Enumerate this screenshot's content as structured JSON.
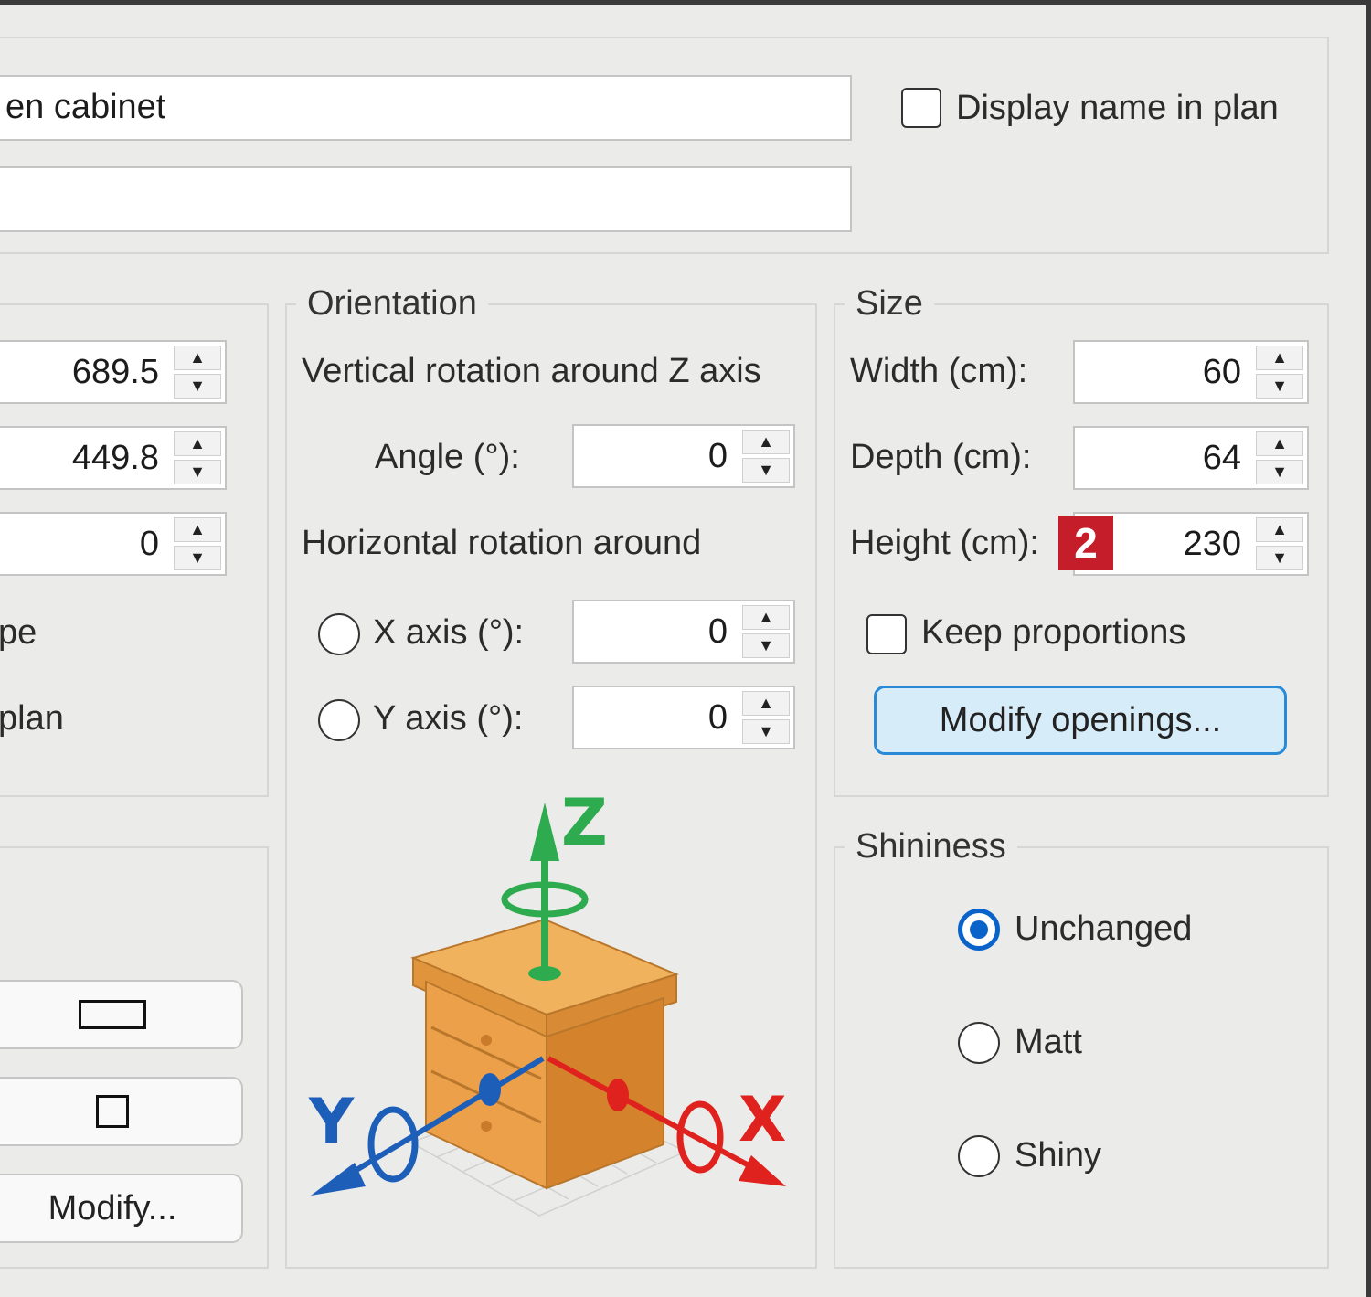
{
  "header": {
    "name_value": "en cabinet",
    "description_value": "",
    "display_name_label": "Display name in plan",
    "display_name_checked": false
  },
  "location": {
    "values": [
      "689.5",
      "449.8",
      "0"
    ],
    "label_fragment_1": "pe",
    "label_fragment_2": "plan"
  },
  "left_bottom": {
    "modify_label": "Modify..."
  },
  "orientation": {
    "title": "Orientation",
    "vertical_label": "Vertical rotation around Z axis",
    "angle_label": "Angle (°):",
    "angle_value": "0",
    "horizontal_label": "Horizontal rotation around",
    "x_axis_label": "X axis (°):",
    "x_axis_value": "0",
    "y_axis_label": "Y axis (°):",
    "y_axis_value": "0",
    "axis_labels": {
      "z": "Z",
      "y": "Y",
      "x": "X"
    }
  },
  "size": {
    "title": "Size",
    "width_label": "Width (cm):",
    "width_value": "60",
    "depth_label": "Depth (cm):",
    "depth_value": "64",
    "height_label": "Height (cm):",
    "height_value": "230",
    "callout_badge": "2",
    "keep_proportions_label": "Keep proportions",
    "keep_proportions_checked": false,
    "modify_openings_label": "Modify openings..."
  },
  "shininess": {
    "title": "Shininess",
    "options": [
      "Unchanged",
      "Matt",
      "Shiny"
    ],
    "selected": "Unchanged"
  },
  "colors": {
    "accent": "#0a63c8",
    "badge": "#c51d2a",
    "z_axis": "#2eab4f",
    "y_axis": "#1d5fb8",
    "x_axis": "#e0221e"
  }
}
